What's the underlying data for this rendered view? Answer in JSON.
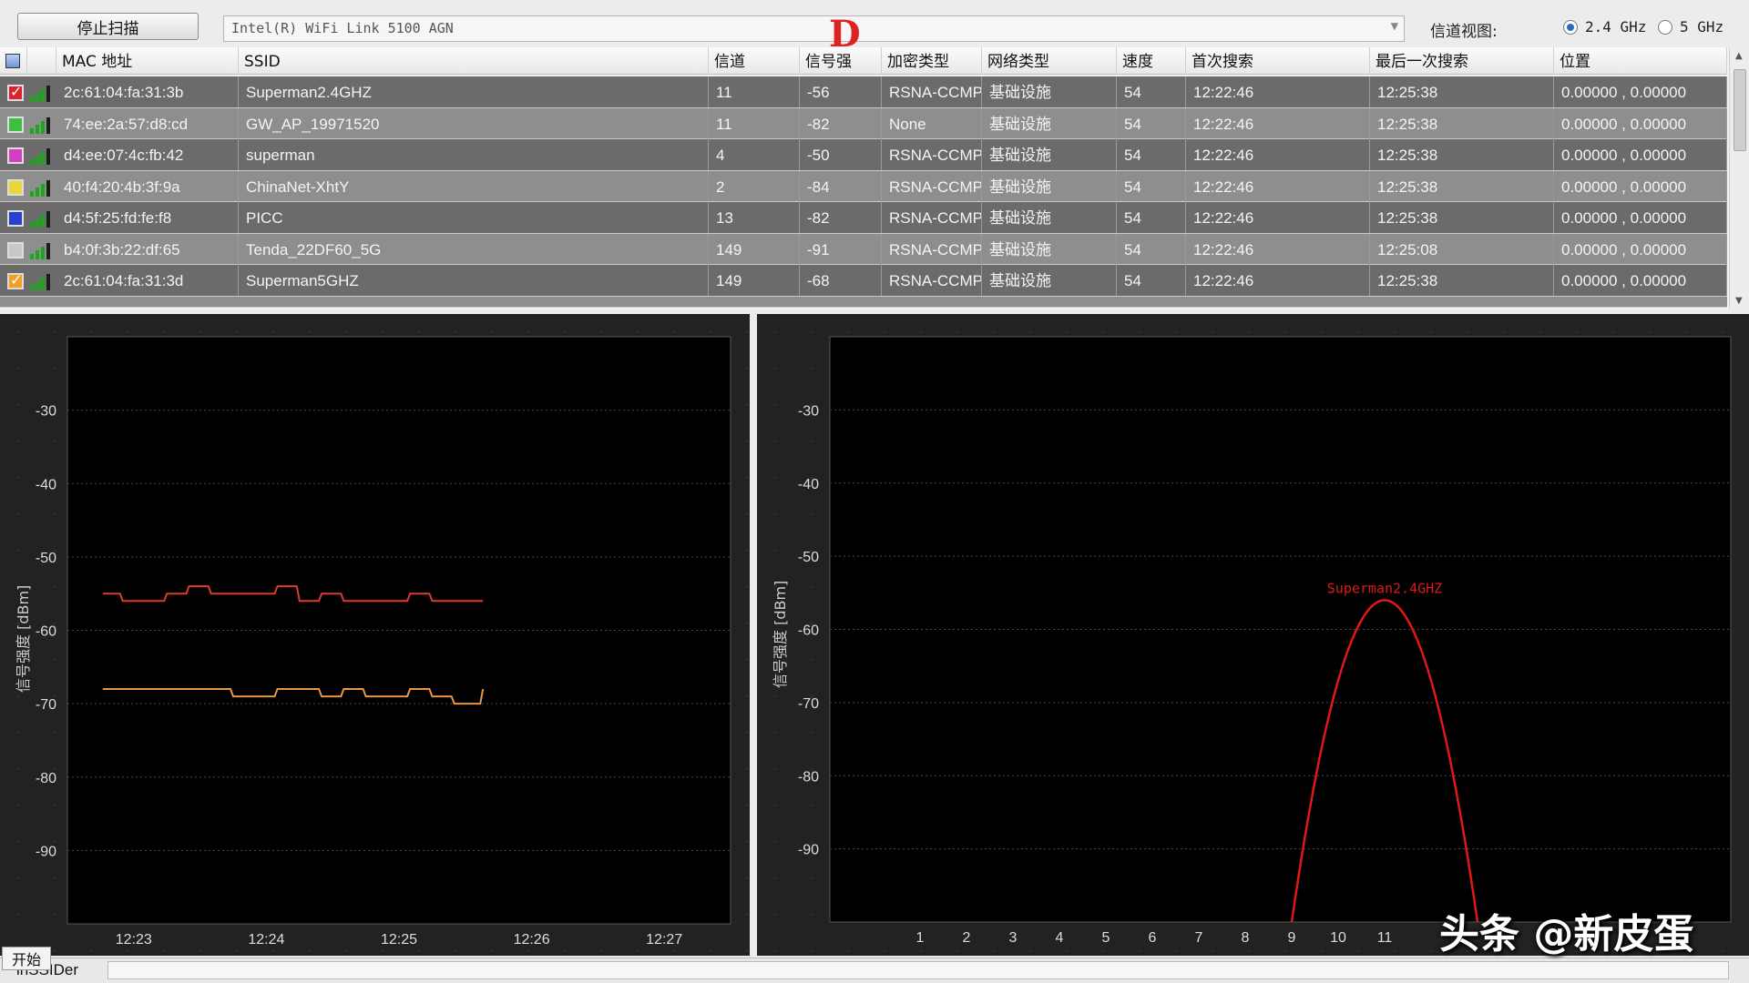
{
  "toolbar": {
    "stop_scan_label": "停止扫描",
    "adapter_value": "Intel(R) WiFi Link 5100 AGN",
    "channel_view_label": "信道视图:",
    "band_24_label": "2.4 GHz",
    "band_5_label": "5 GHz",
    "selected_band": "2.4 GHz",
    "annotation_mark": "D"
  },
  "table": {
    "columns": [
      "MAC 地址",
      "SSID",
      "信道",
      "信号强",
      "加密类型",
      "网络类型",
      "速度",
      "首次搜索",
      "最后一次搜索",
      "位置"
    ],
    "rows": [
      {
        "color": "#d9242b",
        "checked": true,
        "mac": "2c:61:04:fa:31:3b",
        "ssid": "Superman2.4GHZ",
        "channel": "11",
        "rssi": "-56",
        "security": "RSNA-CCMP",
        "network_type": "基础设施",
        "speed": "54",
        "first_seen": "12:22:46",
        "last_seen": "12:25:38",
        "location": "0.00000 , 0.00000"
      },
      {
        "color": "#3fbf3f",
        "checked": false,
        "mac": "74:ee:2a:57:d8:cd",
        "ssid": "GW_AP_19971520",
        "channel": "11",
        "rssi": "-82",
        "security": "None",
        "network_type": "基础设施",
        "speed": "54",
        "first_seen": "12:22:46",
        "last_seen": "12:25:38",
        "location": "0.00000 , 0.00000"
      },
      {
        "color": "#d23fc0",
        "checked": false,
        "mac": "d4:ee:07:4c:fb:42",
        "ssid": "superman",
        "channel": "4",
        "rssi": "-50",
        "security": "RSNA-CCMP",
        "network_type": "基础设施",
        "speed": "54",
        "first_seen": "12:22:46",
        "last_seen": "12:25:38",
        "location": "0.00000 , 0.00000"
      },
      {
        "color": "#e8d63a",
        "checked": false,
        "mac": "40:f4:20:4b:3f:9a",
        "ssid": "ChinaNet-XhtY",
        "channel": "2",
        "rssi": "-84",
        "security": "RSNA-CCMP",
        "network_type": "基础设施",
        "speed": "54",
        "first_seen": "12:22:46",
        "last_seen": "12:25:38",
        "location": "0.00000 , 0.00000"
      },
      {
        "color": "#2a3fd0",
        "checked": false,
        "mac": "d4:5f:25:fd:fe:f8",
        "ssid": "PICC",
        "channel": "13",
        "rssi": "-82",
        "security": "RSNA-CCMP",
        "network_type": "基础设施",
        "speed": "54",
        "first_seen": "12:22:46",
        "last_seen": "12:25:38",
        "location": "0.00000 , 0.00000"
      },
      {
        "color": "#c8c8c8",
        "checked": false,
        "mac": "b4:0f:3b:22:df:65",
        "ssid": "Tenda_22DF60_5G",
        "channel": "149",
        "rssi": "-91",
        "security": "RSNA-CCMP",
        "network_type": "基础设施",
        "speed": "54",
        "first_seen": "12:22:46",
        "last_seen": "12:25:08",
        "location": "0.00000 , 0.00000"
      },
      {
        "color": "#f0a028",
        "checked": true,
        "mac": "2c:61:04:fa:31:3d",
        "ssid": "Superman5GHZ",
        "channel": "149",
        "rssi": "-68",
        "security": "RSNA-CCMP",
        "network_type": "基础设施",
        "speed": "54",
        "first_seen": "12:22:46",
        "last_seen": "12:25:38",
        "location": "0.00000 , 0.00000"
      }
    ]
  },
  "chart_data": [
    {
      "type": "line",
      "title": "",
      "xlabel": "",
      "ylabel": "信号强度 [dBm]",
      "x_ticks": [
        "12:23",
        "12:24",
        "12:25",
        "12:26",
        "12:27"
      ],
      "y_ticks": [
        -30,
        -40,
        -50,
        -60,
        -70,
        -80,
        -90
      ],
      "ylim": [
        -100,
        -20
      ],
      "grid": true,
      "series": [
        {
          "color": "#e03a2a",
          "x": [
            "12:22:46",
            "12:22:55",
            "12:23:05",
            "12:23:15",
            "12:23:25",
            "12:23:35",
            "12:23:45",
            "12:23:55",
            "12:24:05",
            "12:24:15",
            "12:24:25",
            "12:24:35",
            "12:24:45",
            "12:24:55",
            "12:25:05",
            "12:25:15",
            "12:25:25",
            "12:25:38"
          ],
          "y": [
            -55,
            -56,
            -56,
            -55,
            -54,
            -55,
            -55,
            -55,
            -54,
            -56,
            -55,
            -56,
            -56,
            -56,
            -55,
            -56,
            -56,
            -56
          ]
        },
        {
          "color": "#e8964a",
          "x": [
            "12:22:46",
            "12:22:55",
            "12:23:05",
            "12:23:15",
            "12:23:25",
            "12:23:35",
            "12:23:45",
            "12:23:55",
            "12:24:05",
            "12:24:15",
            "12:24:25",
            "12:24:35",
            "12:24:45",
            "12:24:55",
            "12:25:05",
            "12:25:15",
            "12:25:25",
            "12:25:38"
          ],
          "y": [
            -68,
            -68,
            -68,
            -68,
            -68,
            -68,
            -69,
            -69,
            -68,
            -68,
            -69,
            -68,
            -69,
            -69,
            -68,
            -69,
            -70,
            -68
          ]
        }
      ]
    },
    {
      "type": "line",
      "title": "",
      "xlabel": "",
      "ylabel": "信号强度 [dBm]",
      "x_ticks": [
        "1",
        "2",
        "3",
        "4",
        "5",
        "6",
        "7",
        "8",
        "9",
        "10",
        "11"
      ],
      "y_ticks": [
        -30,
        -40,
        -50,
        -60,
        -70,
        -80,
        -90
      ],
      "ylim": [
        -100,
        -20
      ],
      "grid": true,
      "series": [
        {
          "name": "Superman2.4GHZ",
          "color": "#e01818",
          "center_channel": 11,
          "width_channels": 4,
          "peak": -56
        }
      ]
    }
  ],
  "statusbar": {
    "start_label": "开始",
    "app_name": "inSSIDer"
  },
  "watermark": "头条 @新皮蛋"
}
